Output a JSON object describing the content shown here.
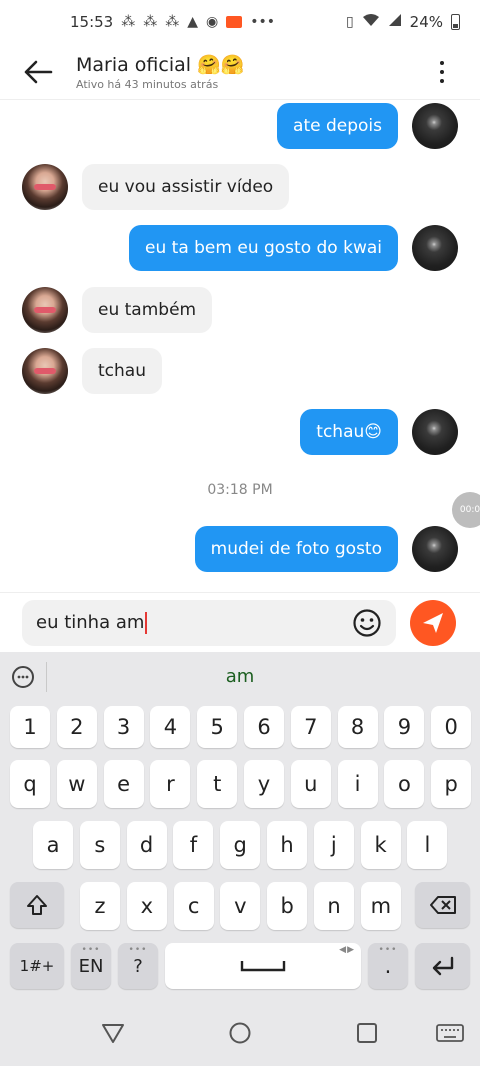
{
  "status_bar": {
    "time": "15:53",
    "battery": "24%"
  },
  "header": {
    "title": "Maria oficial 🤗🤗",
    "subtitle": "Ativo há 43 minutos atrás"
  },
  "messages": [
    {
      "direction": "out",
      "text": "ate depois"
    },
    {
      "direction": "in",
      "text": "eu vou assistir vídeo"
    },
    {
      "direction": "out",
      "text": "eu ta bem eu gosto do kwai"
    },
    {
      "direction": "in",
      "text": "eu também"
    },
    {
      "direction": "in",
      "text": "tchau"
    },
    {
      "direction": "out",
      "text": "tchau😊"
    },
    {
      "direction": "out",
      "text": "mudei de foto gosto"
    }
  ],
  "timestamp": "03:18 PM",
  "floating_badge": "00:0",
  "composer": {
    "text": "eu tinha am"
  },
  "keyboard": {
    "suggestion": "am",
    "numbers": [
      "1",
      "2",
      "3",
      "4",
      "5",
      "6",
      "7",
      "8",
      "9",
      "0"
    ],
    "row1": [
      "q",
      "w",
      "e",
      "r",
      "t",
      "y",
      "u",
      "i",
      "o",
      "p"
    ],
    "row2": [
      "a",
      "s",
      "d",
      "f",
      "g",
      "h",
      "j",
      "k",
      "l"
    ],
    "row3": [
      "z",
      "x",
      "c",
      "v",
      "b",
      "n",
      "m"
    ],
    "symbols_label": "1#+",
    "language_label": "EN",
    "question_label": "?",
    "period_label": "."
  },
  "colors": {
    "outgoing_bubble": "#2196f3",
    "incoming_bubble": "#f1f1f1",
    "send_button": "#ff5722",
    "keyboard_bg": "#e8e8ea"
  }
}
